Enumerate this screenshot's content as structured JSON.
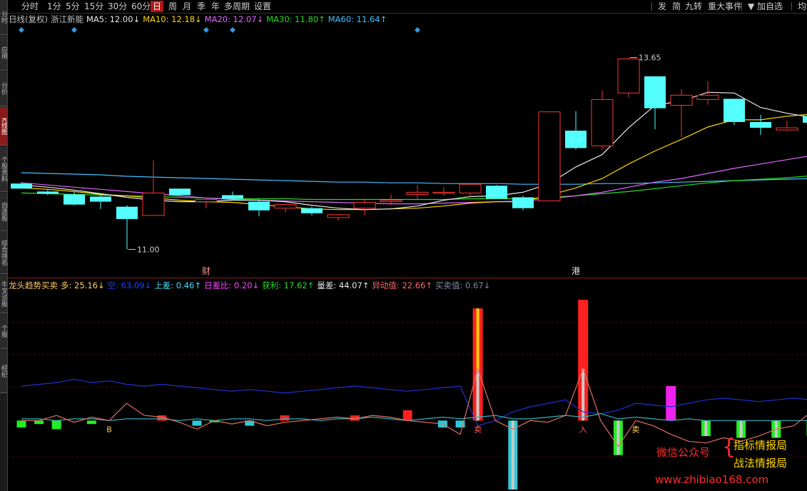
{
  "left_tabs": [
    {
      "label": "分时",
      "active": false
    },
    {
      "label": "应用",
      "active": false
    },
    {
      "label": "分价",
      "active": false
    },
    {
      "label": "K线图",
      "active": true
    },
    {
      "label": "个股资料",
      "active": false
    },
    {
      "label": "自选股",
      "active": false
    },
    {
      "label": "综合排名",
      "active": false
    },
    {
      "label": "牛叉诊股",
      "active": false
    },
    {
      "label": "个股",
      "active": false
    },
    {
      "label": "经纪",
      "active": false
    }
  ],
  "toolbar": {
    "left": [
      {
        "label": "分时",
        "active": false
      },
      {
        "label": "1分",
        "active": false
      },
      {
        "label": "5分",
        "active": false
      },
      {
        "label": "15分",
        "active": false
      },
      {
        "label": "30分",
        "active": false
      },
      {
        "label": "60分",
        "active": false
      },
      {
        "label": "日",
        "active": true
      },
      {
        "label": "周",
        "active": false
      },
      {
        "label": "月",
        "active": false
      },
      {
        "label": "季",
        "active": false
      },
      {
        "label": "年",
        "active": false
      },
      {
        "label": "多周期",
        "active": false
      },
      {
        "label": "设置",
        "active": false
      }
    ],
    "right": [
      "发",
      "简",
      "九转",
      "重大事件",
      "▼",
      "加自选",
      "均线"
    ]
  },
  "legend_main": [
    {
      "text": "日线(复权)",
      "color": "#c0c0c0"
    },
    {
      "text": "浙江新能",
      "color": "#c0c0c0"
    },
    {
      "text": "MA5: 12.00↓",
      "color": "#e8e8e8"
    },
    {
      "text": "MA10: 12.18↓",
      "color": "#ffd700"
    },
    {
      "text": "MA20: 12.07↓",
      "color": "#e066ff"
    },
    {
      "text": "MA30: 11.80↑",
      "color": "#22dd22"
    },
    {
      "text": "MA60: 11.64↑",
      "color": "#40c0ff"
    }
  ],
  "legend_indicator": [
    {
      "text": "龙头趋势买卖",
      "color": "#ffcc66"
    },
    {
      "text": "多: 25.16↓",
      "color": "#ffcc66"
    },
    {
      "text": "空: 63.09↓",
      "color": "#2040ff"
    },
    {
      "text": "上差: 0.46↑",
      "color": "#40e0ff"
    },
    {
      "text": "日差比: 0.20↓",
      "color": "#ff44ff"
    },
    {
      "text": "获利: 17.62↑",
      "color": "#22dd22"
    },
    {
      "text": "量差: 44.07↑",
      "color": "#e8e8e8"
    },
    {
      "text": "异动值: 22.66↑",
      "color": "#ff6666"
    },
    {
      "text": "买卖值: 0.67↓",
      "color": "#7a8ca0"
    }
  ],
  "chart_data": {
    "type": "candlestick",
    "colors": {
      "up": "#ff3333",
      "down": "#54ffff",
      "ma5": "#e8e8e8",
      "ma10": "#ffd700",
      "ma20": "#e066ff",
      "ma30": "#22dd22",
      "ma60": "#40c0ff"
    },
    "ylim": [
      10.7,
      14.05
    ],
    "candles": [
      {
        "o": 11.91,
        "h": 11.93,
        "l": 11.84,
        "c": 11.84
      },
      {
        "o": 11.8,
        "h": 11.83,
        "l": 11.75,
        "c": 11.77
      },
      {
        "o": 11.76,
        "h": 11.8,
        "l": 11.61,
        "c": 11.62
      },
      {
        "o": 11.73,
        "h": 11.77,
        "l": 11.56,
        "c": 11.66
      },
      {
        "o": 11.59,
        "h": 11.61,
        "l": 11.0,
        "c": 11.42
      },
      {
        "o": 11.47,
        "h": 12.23,
        "l": 11.47,
        "c": 11.78
      },
      {
        "o": 11.84,
        "h": 11.84,
        "l": 11.75,
        "c": 11.75
      },
      {
        "o": 11.66,
        "h": 11.7,
        "l": 11.57,
        "c": 11.69
      },
      {
        "o": 11.75,
        "h": 11.8,
        "l": 11.69,
        "c": 11.7
      },
      {
        "o": 11.66,
        "h": 11.69,
        "l": 11.46,
        "c": 11.54
      },
      {
        "o": 11.57,
        "h": 11.62,
        "l": 11.51,
        "c": 11.62
      },
      {
        "o": 11.57,
        "h": 11.59,
        "l": 11.47,
        "c": 11.5
      },
      {
        "o": 11.44,
        "h": 11.48,
        "l": 11.4,
        "c": 11.48
      },
      {
        "o": 11.57,
        "h": 11.7,
        "l": 11.47,
        "c": 11.65
      },
      {
        "o": 11.66,
        "h": 11.76,
        "l": 11.62,
        "c": 11.68
      },
      {
        "o": 11.76,
        "h": 11.89,
        "l": 11.7,
        "c": 11.79
      },
      {
        "o": 11.79,
        "h": 11.86,
        "l": 11.74,
        "c": 11.79
      },
      {
        "o": 11.78,
        "h": 11.91,
        "l": 11.72,
        "c": 11.9
      },
      {
        "o": 11.88,
        "h": 11.89,
        "l": 11.7,
        "c": 11.7
      },
      {
        "o": 11.72,
        "h": 11.74,
        "l": 11.54,
        "c": 11.57
      },
      {
        "o": 11.67,
        "h": 12.9,
        "l": 11.67,
        "c": 12.9
      },
      {
        "o": 12.64,
        "h": 12.91,
        "l": 12.38,
        "c": 12.4
      },
      {
        "o": 12.43,
        "h": 13.2,
        "l": 12.38,
        "c": 13.07
      },
      {
        "o": 13.16,
        "h": 13.65,
        "l": 13.1,
        "c": 13.63
      },
      {
        "o": 13.39,
        "h": 13.39,
        "l": 12.66,
        "c": 12.95
      },
      {
        "o": 12.99,
        "h": 13.21,
        "l": 12.55,
        "c": 13.13
      },
      {
        "o": 13.07,
        "h": 13.32,
        "l": 13.0,
        "c": 13.13
      },
      {
        "o": 13.08,
        "h": 13.08,
        "l": 12.72,
        "c": 12.76
      },
      {
        "o": 12.76,
        "h": 12.86,
        "l": 12.58,
        "c": 12.68
      },
      {
        "o": 12.65,
        "h": 12.78,
        "l": 12.63,
        "c": 12.68
      },
      {
        "o": 12.84,
        "h": 12.86,
        "l": 12.62,
        "c": 12.75
      }
    ],
    "ma5": [
      11.89,
      11.86,
      11.82,
      11.77,
      11.72,
      11.68,
      11.66,
      11.66,
      11.68,
      11.68,
      11.66,
      11.61,
      11.57,
      11.55,
      11.56,
      11.6,
      11.68,
      11.73,
      11.74,
      11.79,
      11.91,
      12.14,
      12.31,
      12.68,
      12.99,
      13.05,
      13.17,
      13.16,
      12.96,
      12.88,
      12.82
    ],
    "ma10": [
      11.85,
      11.83,
      11.8,
      11.76,
      11.74,
      11.71,
      11.68,
      11.66,
      11.65,
      11.62,
      11.59,
      11.56,
      11.55,
      11.55,
      11.56,
      11.57,
      11.6,
      11.64,
      11.66,
      11.66,
      11.75,
      11.85,
      11.98,
      12.18,
      12.36,
      12.52,
      12.69,
      12.79,
      12.79,
      12.84,
      12.87
    ],
    "ma20": [
      11.92,
      11.89,
      11.86,
      11.83,
      11.8,
      11.77,
      11.74,
      11.71,
      11.69,
      11.68,
      11.67,
      11.66,
      11.65,
      11.64,
      11.63,
      11.63,
      11.64,
      11.65,
      11.66,
      11.67,
      11.7,
      11.74,
      11.79,
      11.86,
      11.93,
      11.98,
      12.05,
      12.12,
      12.18,
      12.24,
      12.3
    ],
    "ma30": [
      11.78,
      11.77,
      11.76,
      11.75,
      11.74,
      11.73,
      11.72,
      11.71,
      11.7,
      11.7,
      11.7,
      11.69,
      11.69,
      11.69,
      11.69,
      11.69,
      11.69,
      11.7,
      11.7,
      11.7,
      11.72,
      11.74,
      11.77,
      11.8,
      11.84,
      11.88,
      11.92,
      11.95,
      11.97,
      11.99,
      12.02
    ],
    "ma60": [
      12.06,
      12.05,
      12.04,
      12.03,
      12.01,
      12.0,
      11.99,
      11.98,
      11.97,
      11.96,
      11.95,
      11.94,
      11.93,
      11.93,
      11.92,
      11.92,
      11.91,
      11.91,
      11.91,
      11.9,
      11.9,
      11.9,
      11.91,
      11.91,
      11.92,
      11.93,
      11.94,
      11.95,
      11.96,
      11.97,
      11.98
    ],
    "diamond_markers": [
      0,
      2,
      7,
      8,
      15
    ],
    "text_markers": [
      {
        "index": 7,
        "text": "财",
        "color": "#ff9090"
      },
      {
        "index": 21,
        "text": "港",
        "color": "#e8e8e8"
      }
    ],
    "high_label": {
      "index": 23,
      "value": "13.65"
    },
    "low_label": {
      "index": 4,
      "value": "11.00"
    },
    "indicator": {
      "ylim": [
        -40,
        75
      ],
      "bars": [
        -4,
        -2,
        -5,
        0,
        -2,
        0,
        0,
        0,
        3,
        0,
        -3,
        -1,
        0,
        -3,
        0,
        3,
        0,
        0,
        0,
        3,
        0,
        0,
        6,
        0,
        -4,
        -4,
        0,
        0,
        -40,
        0,
        0,
        0,
        0,
        0,
        -20,
        0,
        0,
        20,
        0,
        -9,
        0,
        -10,
        0,
        -10,
        0,
        -9
      ],
      "gray": [
        0,
        0,
        0,
        0,
        0,
        0,
        0,
        0,
        0,
        0,
        0,
        0,
        0,
        0,
        0,
        0,
        0,
        0,
        0,
        0,
        0,
        0,
        0,
        0,
        0,
        0,
        30,
        0,
        -40,
        0,
        0,
        0,
        30,
        0,
        -20,
        0,
        0,
        0,
        0,
        -9,
        0,
        -10,
        0,
        -10,
        0,
        -9
      ],
      "spikes": [
        {
          "index": 26,
          "value": 65,
          "color": "#ff2020",
          "inner": "#ffd000"
        },
        {
          "index": 32,
          "value": 70,
          "color": "#ff2020",
          "inner": "#ff2020"
        }
      ],
      "magenta": [
        {
          "index": 37,
          "value": 20
        }
      ],
      "blue_line": [
        20,
        21,
        22,
        24,
        22,
        23,
        21,
        20,
        21,
        20,
        19,
        18,
        17,
        18,
        17,
        16,
        17,
        18,
        19,
        20,
        19,
        18,
        17,
        18,
        19,
        20,
        -3,
        0,
        5,
        8,
        10,
        12,
        5,
        4,
        6,
        10,
        9,
        8,
        10,
        12,
        13,
        12,
        11,
        12,
        13,
        12
      ],
      "orange_line": [
        0,
        0,
        3,
        -1,
        2,
        0,
        10,
        3,
        2,
        -1,
        -5,
        0,
        -2,
        0,
        -3,
        -1,
        0,
        1,
        2,
        1,
        3,
        2,
        0,
        -1,
        -2,
        -8,
        30,
        0,
        -5,
        0,
        -1,
        3,
        30,
        0,
        -15,
        0,
        -3,
        -8,
        -12,
        -13,
        -10,
        -12,
        -9,
        -5,
        -3,
        5
      ],
      "cyan_line": [
        1,
        1,
        0,
        1,
        1,
        0,
        1,
        1,
        1,
        0,
        1,
        0,
        1,
        1,
        0,
        1,
        1,
        0,
        1,
        1,
        2,
        1,
        0,
        1,
        2,
        1,
        2,
        3,
        1,
        1,
        2,
        3,
        2,
        4,
        1,
        2,
        1,
        0,
        1,
        0,
        0,
        0,
        0,
        0,
        0,
        0
      ],
      "labels": [
        {
          "index": 5,
          "text": "B",
          "color": "#ffd060"
        },
        {
          "index": 26,
          "text": "卖",
          "color": "#ff6060"
        },
        {
          "index": 32,
          "text": "入",
          "color": "#ff6060"
        },
        {
          "index": 35,
          "text": "卖",
          "color": "#ffd060"
        }
      ]
    }
  },
  "watermark": {
    "wechat": "微信公众号",
    "brace": "{",
    "name1": "指标情报局",
    "name2": "战法情报局",
    "site": "www.zhibiao168.com"
  }
}
